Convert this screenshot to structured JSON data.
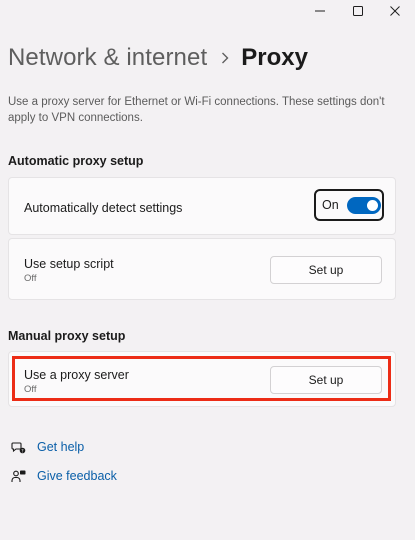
{
  "window": {
    "controls": [
      "minimize",
      "maximize",
      "close"
    ]
  },
  "header": {
    "breadcrumb_parent": "Network & internet",
    "separator_icon": "chevron-right-icon",
    "title": "Proxy"
  },
  "description": "Use a proxy server for Ethernet or Wi-Fi connections. These settings don't apply to VPN connections.",
  "automatic": {
    "section_title": "Automatic proxy setup",
    "detect": {
      "label": "Automatically detect settings",
      "toggle_state": "On",
      "enabled": true
    },
    "script": {
      "label": "Use setup script",
      "status": "Off",
      "button": "Set up"
    }
  },
  "manual": {
    "section_title": "Manual proxy setup",
    "proxy": {
      "label": "Use a proxy server",
      "status": "Off",
      "button": "Set up"
    }
  },
  "links": {
    "help": "Get help",
    "feedback": "Give feedback"
  },
  "colors": {
    "accent": "#0067c0",
    "link": "#0a5fa8",
    "highlight": "#ec2c16",
    "background": "#f3f1f3"
  }
}
